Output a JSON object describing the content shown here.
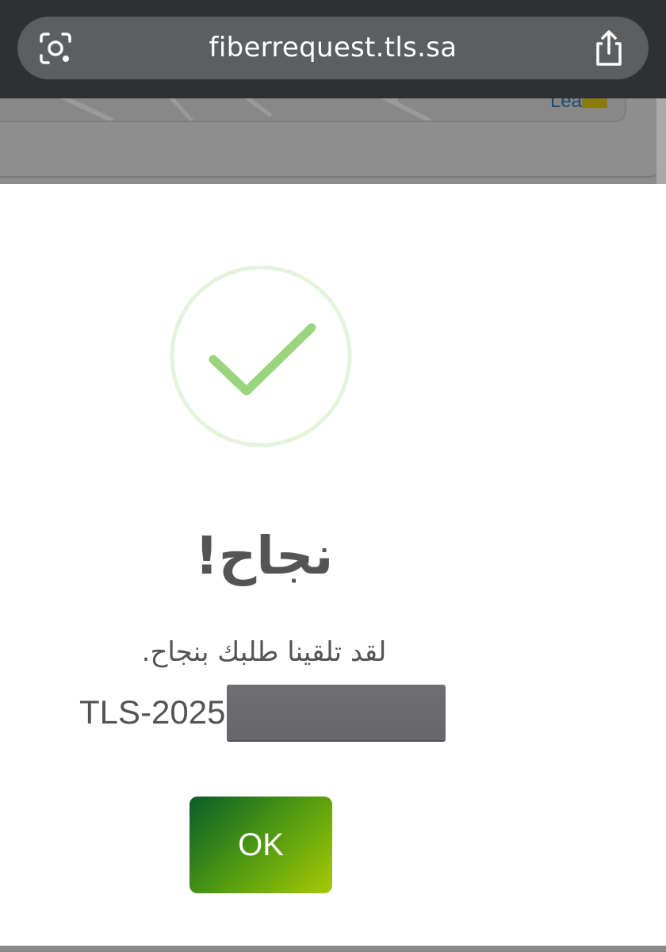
{
  "browser": {
    "url": "fiberrequest.tls.sa",
    "left_icon": "camera-search-icon",
    "right_icon": "share-icon"
  },
  "background_page": {
    "map_attribution": "Leaflet"
  },
  "modal": {
    "icon": "success-check-icon",
    "title": "نجاح!",
    "message": "لقد تلقينا طلبك بنجاح.",
    "reference_prefix": "TLS-2025",
    "ok_label": "OK"
  },
  "colors": {
    "check_ring": "#e4f4dc",
    "check_mark": "#9ad47e",
    "button_start": "#0a5c2a",
    "button_end": "#a8c904",
    "text": "#545454"
  }
}
